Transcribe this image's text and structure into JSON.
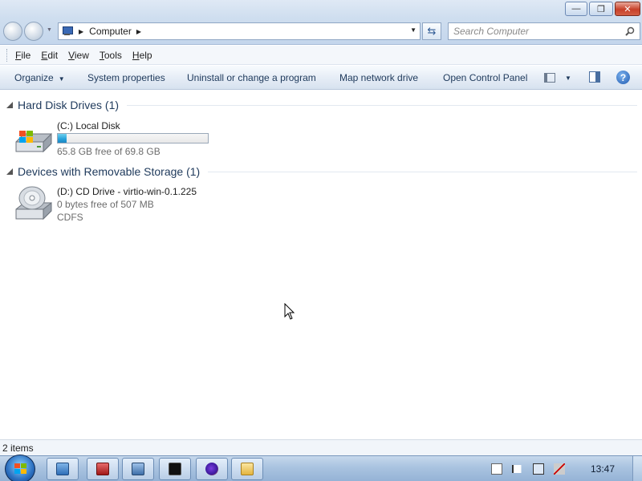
{
  "window": {
    "caption_buttons": {
      "minimize": "—",
      "restore": "❐",
      "close": "✕"
    }
  },
  "navigation": {
    "address_path": "Computer",
    "search_placeholder": "Search Computer",
    "refresh_glyph": "⇆"
  },
  "menu": [
    {
      "label": "File",
      "u": "F",
      "rest": "ile"
    },
    {
      "label": "Edit",
      "u": "E",
      "rest": "dit"
    },
    {
      "label": "View",
      "u": "V",
      "rest": "iew"
    },
    {
      "label": "Tools",
      "u": "T",
      "rest": "ools"
    },
    {
      "label": "Help",
      "u": "H",
      "rest": "elp"
    }
  ],
  "commands": {
    "organize": "Organize",
    "system_properties": "System properties",
    "uninstall": "Uninstall or change a program",
    "map_drive": "Map network drive",
    "control_panel": "Open Control Panel",
    "help": "?"
  },
  "groups": {
    "hard_disks": {
      "title": "Hard Disk Drives (1)",
      "drives": [
        {
          "name": "(C:) Local Disk",
          "free_text": "65.8 GB free of 69.8 GB",
          "used_fraction": 0.057
        }
      ]
    },
    "removable": {
      "title": "Devices with Removable Storage (1)",
      "drives": [
        {
          "name": "(D:) CD Drive - virtio-win-0.1.225",
          "free_text": "0 bytes free of 507 MB",
          "filesystem": "CDFS"
        }
      ]
    }
  },
  "status": {
    "items": "2 items"
  },
  "taskbar": {
    "clock": "13:47",
    "apps": [
      "control-panel-icon",
      "toolbox-icon",
      "network-icon",
      "command-prompt-icon",
      "firefox-icon",
      "explorer-icon"
    ]
  },
  "colors": {
    "usage_bar": "#26a0da",
    "command_text": "#1e395b",
    "group_header": "#1e395b"
  }
}
